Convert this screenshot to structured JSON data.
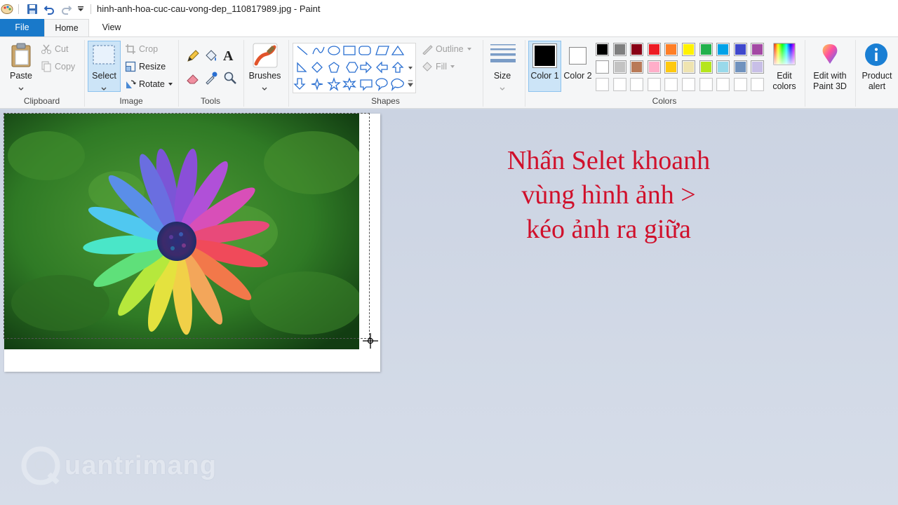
{
  "window": {
    "title": "hinh-anh-hoa-cuc-cau-vong-dep_110817989.jpg - Paint"
  },
  "tabs": {
    "file": "File",
    "home": "Home",
    "view": "View"
  },
  "clipboard": {
    "paste": "Paste",
    "cut": "Cut",
    "copy": "Copy",
    "label": "Clipboard"
  },
  "image": {
    "select": "Select",
    "crop": "Crop",
    "resize": "Resize",
    "rotate": "Rotate",
    "label": "Image"
  },
  "tools": {
    "label": "Tools"
  },
  "brushes": {
    "label": "Brushes"
  },
  "shapes": {
    "outline": "Outline",
    "fill": "Fill",
    "label": "Shapes"
  },
  "size": {
    "label": "Size"
  },
  "colors": {
    "color1": "Color 1",
    "color2": "Color 2",
    "color1_value": "#000000",
    "color2_value": "#ffffff",
    "edit": "Edit colors",
    "label": "Colors",
    "palette_row1": [
      "#000000",
      "#7f7f7f",
      "#880015",
      "#ed1c24",
      "#ff7f27",
      "#fff200",
      "#22b14c",
      "#00a2e8",
      "#3f48cc",
      "#a349a4"
    ],
    "palette_row2": [
      "#ffffff",
      "#c3c3c3",
      "#b97a57",
      "#ffaec9",
      "#ffc90e",
      "#efe4b0",
      "#b5e61d",
      "#99d9ea",
      "#7092be",
      "#c8bfe7"
    ],
    "palette_row3": [
      "#ffffff",
      "#ffffff",
      "#ffffff",
      "#ffffff",
      "#ffffff",
      "#ffffff",
      "#ffffff",
      "#ffffff",
      "#ffffff",
      "#ffffff"
    ]
  },
  "paint3d": {
    "label": "Edit with Paint 3D"
  },
  "product_alert": {
    "label": "Product alert"
  },
  "annotation": {
    "line1": "Nhấn Selet khoanh",
    "line2": "vùng hình ảnh >",
    "line3": "kéo ảnh ra giữa"
  },
  "watermark": {
    "text": "uantrimang"
  }
}
